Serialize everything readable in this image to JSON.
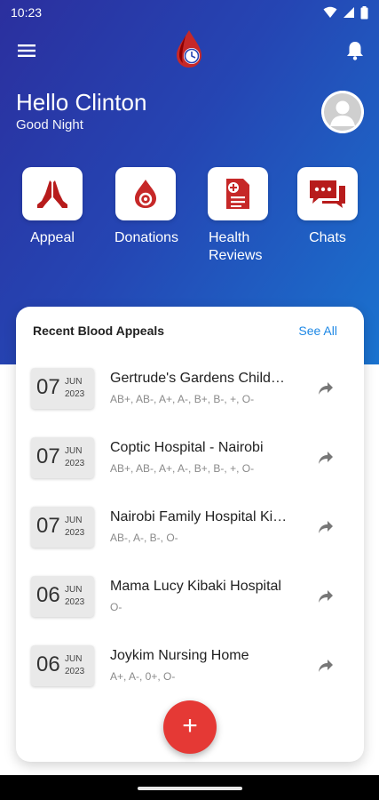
{
  "status_bar": {
    "time": "10:23"
  },
  "header": {
    "greeting": "Hello Clinton",
    "subgreeting": "Good Night"
  },
  "quick_actions": [
    {
      "label": "Appeal",
      "icon": "praying-hands-icon"
    },
    {
      "label": "Donations",
      "icon": "blood-drop-icon"
    },
    {
      "label": "Health\nReviews",
      "icon": "medical-report-icon"
    },
    {
      "label": "Chats",
      "icon": "chat-bubbles-icon"
    }
  ],
  "appeals_card": {
    "title": "Recent Blood Appeals",
    "see_all": "See All",
    "items": [
      {
        "day": "07",
        "month": "JUN",
        "year": "2023",
        "hospital": "Gertrude's Gardens Children's Hospital",
        "groups": "AB+, AB-, A+, A-, B+, B-, +, O-"
      },
      {
        "day": "07",
        "month": "JUN",
        "year": "2023",
        "hospital": "Coptic Hospital - Nairobi",
        "groups": "AB+, AB-, A+, A-, B+, B-, +, O-"
      },
      {
        "day": "07",
        "month": "JUN",
        "year": "2023",
        "hospital": "Nairobi Family Hospital Kitengela",
        "groups": "AB-, A-, B-, O-"
      },
      {
        "day": "06",
        "month": "JUN",
        "year": "2023",
        "hospital": "Mama Lucy Kibaki Hospital",
        "groups": "O-"
      },
      {
        "day": "06",
        "month": "JUN",
        "year": "2023",
        "hospital": "Joykim Nursing Home",
        "groups": "A+, A-, 0+, O-"
      }
    ]
  },
  "fab": {
    "label": "+"
  },
  "colors": {
    "brand_red": "#b71c1c",
    "accent_blue": "#1e88e5",
    "fab_red": "#e53935",
    "gradient_start": "#2b2f9e",
    "gradient_end": "#1a73cf"
  }
}
